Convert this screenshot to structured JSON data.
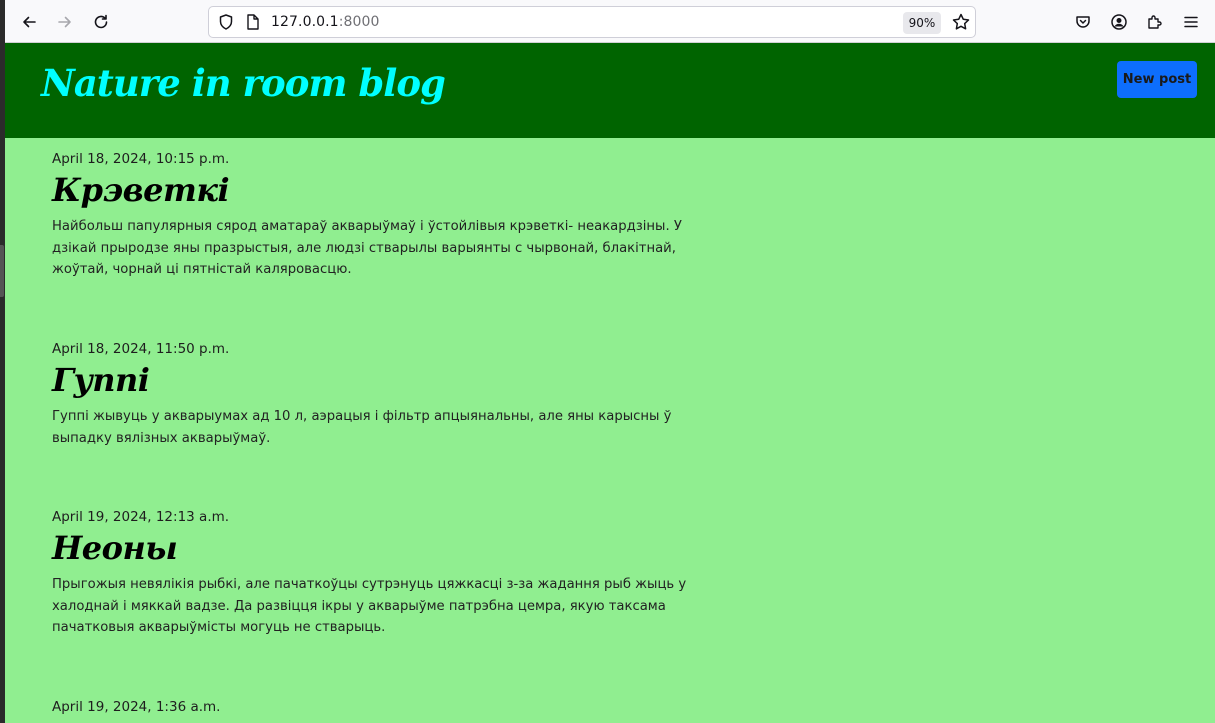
{
  "browser": {
    "url_host": "127.0.0.1",
    "url_port": ":8000",
    "zoom": "90%",
    "icons": {
      "back": "arrow-left-icon",
      "forward": "arrow-right-icon",
      "reload": "reload-icon",
      "shield": "shield-icon",
      "page": "page-icon",
      "star": "star-icon",
      "pocket": "pocket-icon",
      "account": "account-icon",
      "extensions": "puzzle-icon",
      "menu": "hamburger-menu-icon"
    }
  },
  "site": {
    "title": "Nature in room blog",
    "new_post_label": "New post",
    "colors": {
      "header_bg": "#006400",
      "title": "#00ffff",
      "page_bg": "#90ee90",
      "button": "#0d6efd"
    }
  },
  "posts": [
    {
      "date": "April 18, 2024, 10:15 p.m.",
      "title": "Крэветкі",
      "body": "Найбольш папулярныя сярод аматараў акварыўмаў і ўстойлівыя крэветкі- неакардзіны. У дзікай прыродзе яны празрыстыя, але людзі стварылы варыянты с чырвонай, блакітнай, жоўтай, чорнай ці пятністай каляровасцю."
    },
    {
      "date": "April 18, 2024, 11:50 p.m.",
      "title": "Гуппі",
      "body": "Гуппі жывуць у акварыумах ад 10 л, аэрацыя і фільтр апцыянальны, але яны карысны ў выпадку вялізных акварыўмаў."
    },
    {
      "date": "April 19, 2024, 12:13 a.m.",
      "title": "Неоны",
      "body": "Прыгожыя невялікія рыбкі, але пачаткоўцы сутрэнуць цяжкасці з-за жадання рыб жыць у халоднай і мяккай вадзе. Да развіцця ікры у акварыўме патрэбна цемра, якую таксама пачатковыя акварыўмісты могуць не стварыць."
    },
    {
      "date": "April 19, 2024, 1:36 a.m.",
      "title": "",
      "body": ""
    }
  ]
}
